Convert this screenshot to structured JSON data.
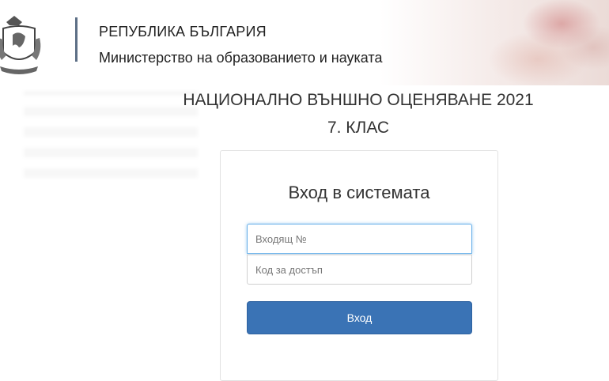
{
  "header": {
    "country": "РЕПУБЛИКА БЪЛГАРИЯ",
    "ministry": "Министерство на образованието и науката"
  },
  "exam": {
    "title": "НАЦИОНАЛНО ВЪНШНО ОЦЕНЯВАНЕ 2021",
    "grade": "7. КЛАС"
  },
  "login": {
    "title": "Вход в системата",
    "user_placeholder": "Входящ №",
    "code_placeholder": "Код за достъп",
    "button_label": "Вход"
  },
  "colors": {
    "accent": "#3a73b5",
    "divider": "#5d6f86"
  }
}
